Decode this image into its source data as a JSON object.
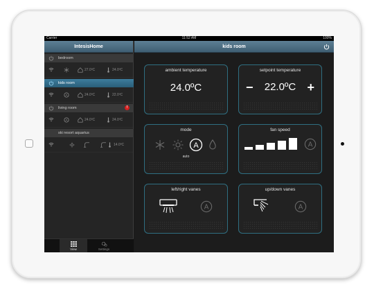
{
  "statusbar": {
    "carrier": "Carrier",
    "time": "11:52 AM",
    "battery": "100%"
  },
  "sidebar": {
    "title": "IntesisHome",
    "devices": [
      {
        "name": "bedroom",
        "temp": "27.0ºC",
        "setpoint": "24.0ºC",
        "active": false,
        "alert": false,
        "mode_icon": "snowflake-icon"
      },
      {
        "name": "kids room",
        "temp": "24.0ºC",
        "setpoint": "22.0ºC",
        "active": true,
        "alert": false,
        "mode_icon": "auto-icon"
      },
      {
        "name": "living room",
        "temp": "24.0ºC",
        "setpoint": "24.0ºC",
        "active": false,
        "alert": true,
        "alert_text": "!",
        "mode_icon": "auto-icon"
      },
      {
        "name": "ski resort aquarius",
        "temp": "",
        "setpoint": "14.0ºC",
        "active": false,
        "alert": false,
        "mode_icon": "sun-icon"
      }
    ],
    "tabs": [
      {
        "label": "View",
        "icon": "grid-icon"
      },
      {
        "label": "Settings",
        "icon": "gears-icon"
      }
    ]
  },
  "main": {
    "title": "kids room",
    "ambient": {
      "title": "ambient temperature",
      "value": "24.0ºC"
    },
    "setpoint": {
      "title": "setpoint temperature",
      "minus": "−",
      "value": "22.0ºC",
      "plus": "+"
    },
    "mode": {
      "title": "mode",
      "selected": "auto",
      "options": [
        "snowflake-icon",
        "sun-icon",
        "auto-icon",
        "drop-icon"
      ]
    },
    "fan": {
      "title": "fan speed",
      "levels": 5,
      "auto_label": "A"
    },
    "lr_vanes": {
      "title": "left/right vanes",
      "auto_label": "A"
    },
    "ud_vanes": {
      "title": "up/down vanes",
      "auto_label": "A"
    }
  },
  "colors": {
    "accent": "#2f6f82",
    "header": "#4d6f84",
    "alert": "#d42020"
  }
}
